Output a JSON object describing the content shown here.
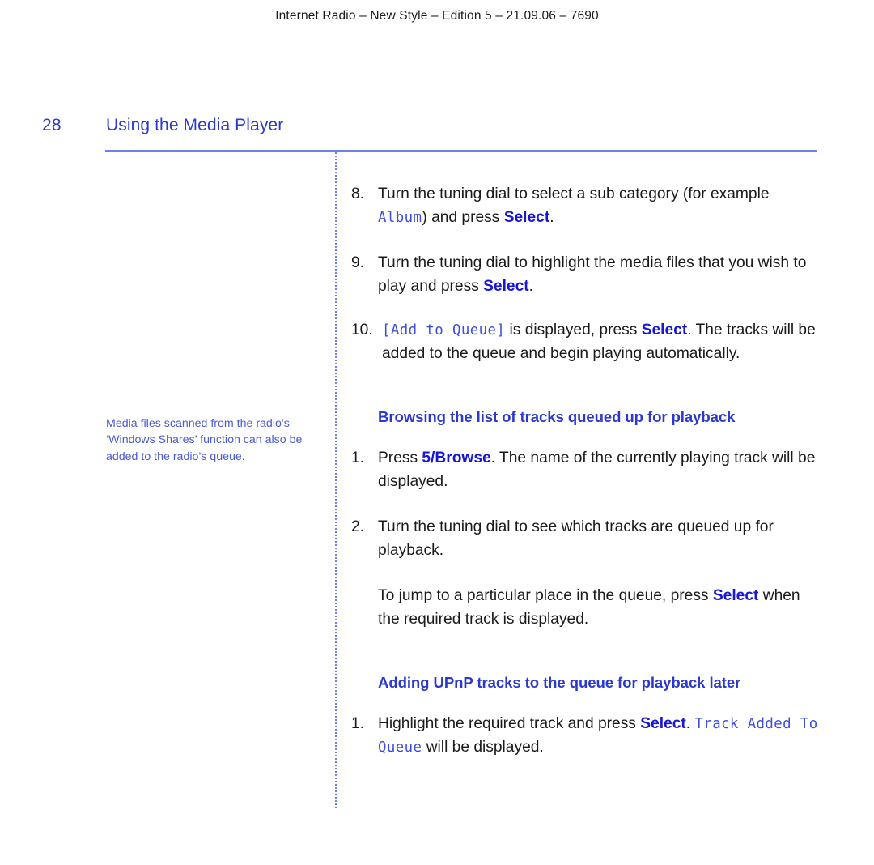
{
  "running_header": "Internet Radio – New Style – Edition 5 – 21.09.06 – 7690",
  "page": {
    "number": "28",
    "chapter_title": "Using the Media Player"
  },
  "side_note": "Media files scanned from the radio’s ‘Windows Shares’ function can also be added to the radio’s queue.",
  "content": {
    "step8": {
      "marker": "8.",
      "text_before": "Turn the tuning dial to select a sub category (for example ",
      "lcd": "Album",
      "text_mid": ") and press ",
      "bold": "Select",
      "text_after": "."
    },
    "step9": {
      "marker": "9.",
      "text_before": "Turn the tuning dial to highlight the media files that you wish to play and press ",
      "bold": "Select",
      "text_after": "."
    },
    "step10": {
      "marker": "10.",
      "lcd": "[Add to Queue]",
      "text_before": " is displayed, press ",
      "bold": "Select",
      "text_after": ". The tracks will be added to the queue and begin playing automatically."
    },
    "heading1": "Browsing the list of tracks queued up for playback",
    "browse1": {
      "marker": "1.",
      "text_before": "Press ",
      "bold": "5/Browse",
      "text_after": ". The name of the currently playing track will be displayed."
    },
    "browse2": {
      "marker": "2.",
      "text": "Turn the tuning dial to see which tracks are queued up for playback."
    },
    "browse_para": {
      "text_before": "To jump to a particular place in the queue, press ",
      "bold": "Select",
      "text_after": " when the required track is displayed."
    },
    "heading2": "Adding UPnP tracks to the queue for playback later",
    "upnp1": {
      "marker": "1.",
      "text_before": "Highlight the required track and press ",
      "bold": "Select",
      "text_mid": ". ",
      "lcd": "Track Added To Queue",
      "text_after": " will be displayed."
    }
  },
  "colors": {
    "accent_blue": "#2b39cf",
    "bold_blue": "#1717d4",
    "lcd_blue": "#3b4ee0",
    "rule_blue": "#6e7ff0",
    "note_blue": "#4a5bd4",
    "body_text": "#1a1a1a"
  }
}
